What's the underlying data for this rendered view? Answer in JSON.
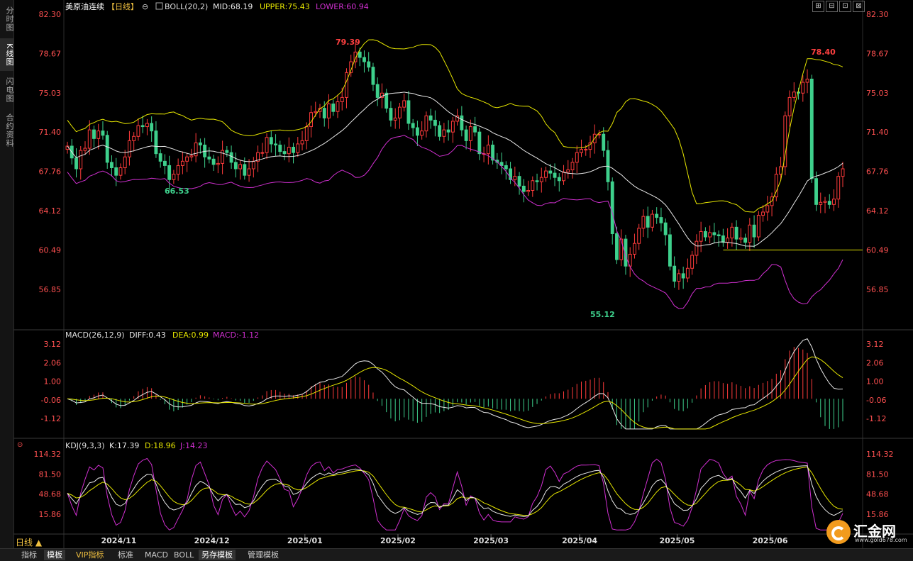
{
  "sidebar": {
    "tabs": [
      {
        "label": "分时图",
        "active": false
      },
      {
        "label": "K线图",
        "active": true
      },
      {
        "label": "闪电图",
        "active": false
      },
      {
        "label": "合约资料",
        "active": false
      }
    ]
  },
  "header": {
    "title": "美原油连续",
    "period_tag": "【日线】",
    "boll_label": "BOLL(20,2)",
    "mid": "MID:68.19",
    "upper": "UPPER:75.43",
    "lower": "LOWER:60.94"
  },
  "window_controls": [
    "⊞",
    "⊟",
    "⊡",
    "⊠"
  ],
  "main_axis": {
    "ticks": [
      "82.30",
      "78.67",
      "75.03",
      "71.40",
      "67.76",
      "64.12",
      "60.49",
      "56.85"
    ],
    "tick_values": [
      82.3,
      78.67,
      75.03,
      71.4,
      67.76,
      64.12,
      60.49,
      56.85
    ]
  },
  "annotations": {
    "high1": "79.39",
    "low1": "66.53",
    "low2": "55.12",
    "high2": "78.40"
  },
  "macd": {
    "label": "MACD(26,12,9)",
    "diff": "DIFF:0.43",
    "dea": "DEA:0.99",
    "macd": "MACD:-1.12",
    "ticks": [
      "3.12",
      "2.06",
      "1.00",
      "-0.06",
      "-1.12"
    ],
    "tick_values": [
      3.12,
      2.06,
      1.0,
      -0.06,
      -1.12
    ]
  },
  "kdj": {
    "label": "KDJ(9,3,3)",
    "k": "K:17.39",
    "d": "D:18.96",
    "j": "J:14.23",
    "ticks": [
      "114.32",
      "81.50",
      "48.68",
      "15.86"
    ],
    "tick_values": [
      114.32,
      81.5,
      48.68,
      15.86
    ]
  },
  "x_axis": {
    "labels": [
      "2024/11",
      "2024/12",
      "2025/01",
      "2025/02",
      "2025/03",
      "2025/04",
      "2025/05",
      "2025/06"
    ]
  },
  "period_button": "日线 ▲",
  "bottom_tabs": [
    {
      "label": "指标",
      "active": false,
      "vip": false
    },
    {
      "label": "模板",
      "active": true,
      "vip": false
    },
    {
      "label": "VIP指标",
      "active": false,
      "vip": true
    },
    {
      "label": "标准",
      "active": false,
      "vip": false
    },
    {
      "label": "MACD",
      "active": false,
      "vip": false
    },
    {
      "label": "BOLL",
      "active": false,
      "vip": false
    },
    {
      "label": "另存模板",
      "active": true,
      "vip": false
    },
    {
      "label": "管理模板",
      "active": false,
      "vip": false
    }
  ],
  "logo": {
    "name": "汇金网",
    "url": "www.gold678.com"
  },
  "colors": {
    "up": "#ff3b3b",
    "down": "#3ed08c",
    "mid_line": "#e8e8e8",
    "upper_line": "#e6e600",
    "lower_line": "#d02fd0",
    "axis_text": "#ff5050",
    "support_line": "#e6e600"
  },
  "chart_data": {
    "type": "candlestick",
    "support_level": 60.49,
    "closes": [
      70.1,
      69.0,
      68.0,
      69.7,
      69.9,
      71.6,
      70.8,
      71.5,
      71.1,
      68.6,
      68.1,
      67.4,
      68.1,
      69.1,
      70.6,
      71.0,
      72.0,
      71.9,
      72.2,
      71.5,
      69.4,
      68.7,
      68.3,
      67.0,
      67.5,
      68.3,
      68.7,
      69.1,
      69.2,
      70.4,
      70.2,
      69.1,
      68.9,
      68.4,
      68.5,
      69.7,
      69.5,
      68.6,
      68.0,
      68.4,
      67.4,
      68.0,
      68.7,
      69.5,
      69.5,
      70.9,
      70.3,
      70.2,
      69.6,
      69.4,
      70.0,
      69.5,
      70.3,
      70.6,
      71.9,
      73.2,
      73.3,
      73.6,
      72.7,
      74.0,
      73.3,
      74.2,
      74.6,
      76.9,
      77.9,
      78.8,
      78.3,
      77.9,
      77.4,
      75.8,
      74.6,
      75.0,
      73.6,
      72.5,
      72.7,
      73.7,
      74.3,
      72.2,
      71.8,
      71.1,
      71.5,
      72.9,
      72.5,
      72.0,
      71.0,
      71.6,
      71.4,
      72.4,
      72.9,
      71.6,
      70.6,
      71.9,
      71.4,
      69.4,
      69.4,
      70.2,
      68.8,
      68.6,
      68.3,
      68.0,
      67.0,
      67.3,
      66.4,
      65.9,
      66.0,
      66.9,
      66.8,
      67.2,
      67.8,
      67.6,
      67.2,
      66.9,
      67.7,
      67.9,
      68.6,
      69.5,
      69.8,
      69.8,
      70.4,
      71.2,
      71.2,
      69.7,
      66.8,
      62.0,
      59.6,
      61.5,
      59.0,
      60.1,
      61.1,
      62.5,
      63.6,
      62.6,
      63.8,
      63.5,
      63.0,
      61.9,
      59.0,
      57.6,
      58.3,
      57.9,
      58.8,
      60.0,
      61.3,
      62.2,
      61.7,
      62.1,
      61.9,
      61.8,
      61.2,
      61.6,
      62.6,
      61.5,
      61.6,
      61.2,
      62.8,
      61.7,
      63.7,
      64.0,
      64.6,
      65.4,
      67.5,
      68.2,
      72.9,
      74.6,
      75.1,
      75.0,
      76.0,
      76.3,
      67.1,
      64.7,
      64.9,
      65.0,
      64.7,
      65.2,
      67.3,
      68.0
    ]
  }
}
